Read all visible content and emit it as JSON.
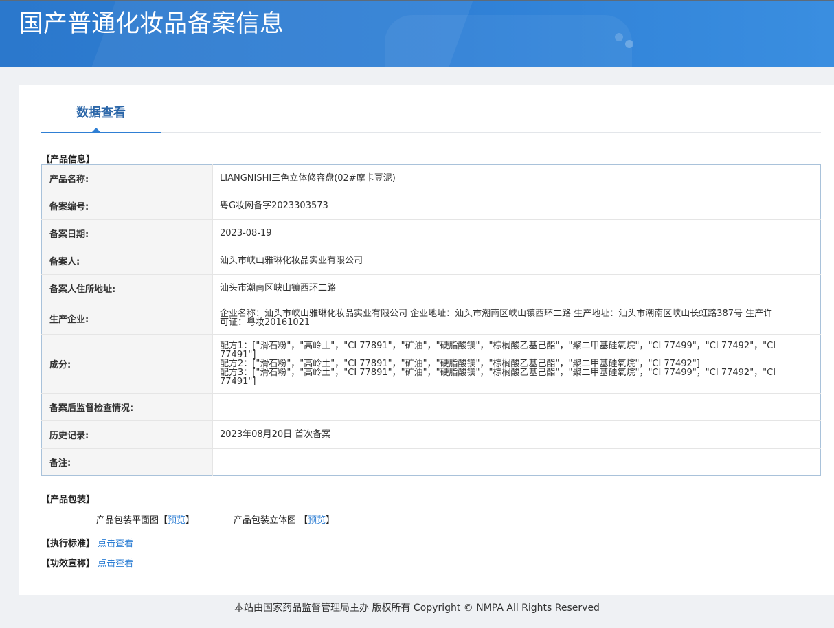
{
  "header": {
    "title": "国产普通化妆品备案信息"
  },
  "tab": {
    "label": "数据查看"
  },
  "product_info": {
    "section_label": "【产品信息】",
    "rows": [
      {
        "key": "产品名称:",
        "value": "LIANGNISHI三色立体修容盘(02#摩卡豆泥)"
      },
      {
        "key": "备案编号:",
        "value": "粤G妆网备字2023303573"
      },
      {
        "key": "备案日期:",
        "value": "2023-08-19"
      },
      {
        "key": "备案人:",
        "value": "汕头市峡山雅琳化妆品实业有限公司"
      },
      {
        "key": "备案人住所地址:",
        "value": "汕头市潮南区峡山镇西环二路"
      },
      {
        "key": "生产企业:",
        "value": "企业名称：汕头市峡山雅琳化妆品实业有限公司 企业地址：汕头市潮南区峡山镇西环二路 生产地址：汕头市潮南区峡山长虹路387号 生产许可证：粤妆20161021"
      },
      {
        "key": "成分:",
        "value": ""
      },
      {
        "key": "备案后监督检查情况:",
        "value": ""
      },
      {
        "key": "历史记录:",
        "value": "2023年08月20日 首次备案"
      },
      {
        "key": "备注:",
        "value": ""
      }
    ],
    "ingredients": [
      "配方1：[\"滑石粉\"，\"高岭土\"，\"CI 77891\"，\"矿油\"，\"硬脂酸镁\"，\"棕榈酸乙基己酯\"，\"聚二甲基硅氧烷\"，\"CI 77499\"，\"CI 77492\"，\"CI 77491\"]",
      "配方2：[\"滑石粉\"，\"高岭土\"，\"CI 77891\"，\"矿油\"，\"硬脂酸镁\"，\"棕榈酸乙基己酯\"，\"聚二甲基硅氧烷\"，\"CI 77492\"]",
      "配方3：[\"滑石粉\"，\"高岭土\"，\"CI 77891\"，\"矿油\"，\"硬脂酸镁\"，\"棕榈酸乙基己酯\"，\"聚二甲基硅氧烷\"，\"CI 77499\"，\"CI 77492\"，\"CI 77491\"]"
    ]
  },
  "packaging": {
    "section_label": "【产品包装】",
    "flat_label": "产品包装平面图【",
    "flat_link": "预览",
    "flat_close": "】",
    "stereo_label": "产品包装立体图 【",
    "stereo_link": "预览",
    "stereo_close": "】"
  },
  "standard": {
    "label": "【执行标准】",
    "link": "点击查看"
  },
  "efficacy": {
    "label": "【功效宣称】",
    "link": "点击查看"
  },
  "footer": {
    "text": "本站由国家药品监督管理局主办 版权所有 Copyright © NMPA All Rights Reserved"
  },
  "colors": {
    "header_blue": "#2f80d6",
    "link_blue": "#2f7fd4",
    "tab_text": "#2b66a8"
  }
}
